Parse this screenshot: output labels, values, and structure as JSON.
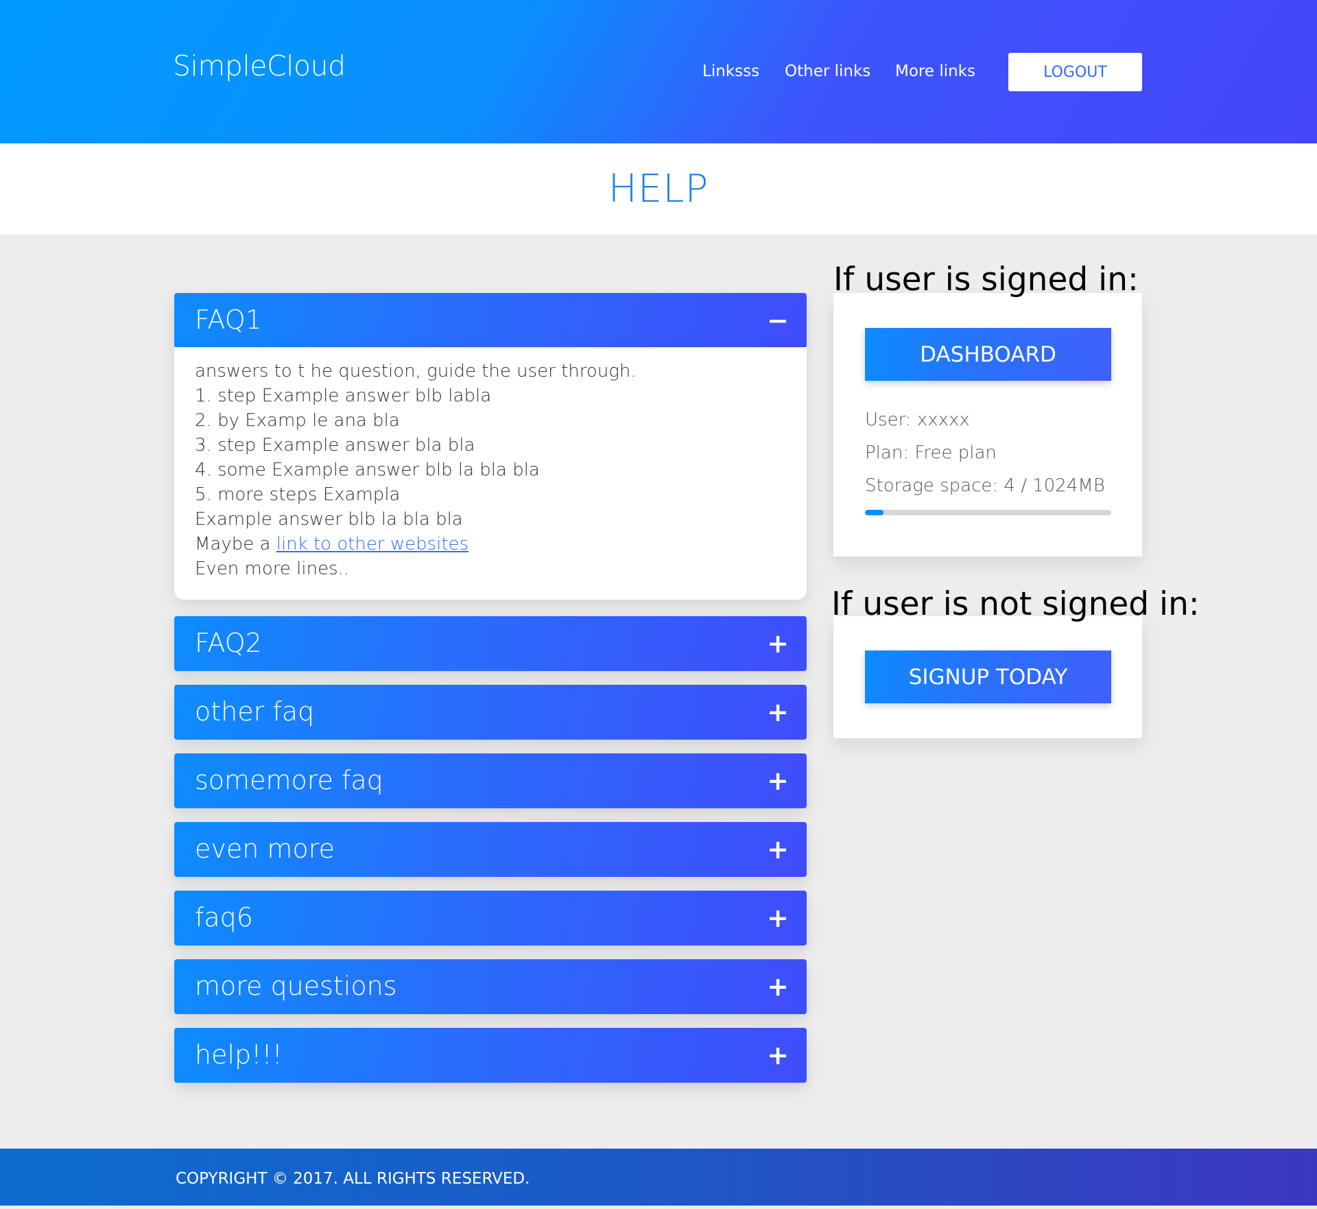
{
  "header": {
    "brand": "SimpleCloud",
    "nav": [
      "Linksss",
      "Other links",
      "More links"
    ],
    "logout_label": "LOGOUT"
  },
  "page": {
    "title": "HELP"
  },
  "faq": {
    "items": [
      {
        "label": "FAQ1",
        "toggle": "−",
        "expanded": true
      },
      {
        "label": "FAQ2",
        "toggle": "+",
        "expanded": false
      },
      {
        "label": "other faq",
        "toggle": "+",
        "expanded": false
      },
      {
        "label": "somemore faq",
        "toggle": "+",
        "expanded": false
      },
      {
        "label": "even more",
        "toggle": "+",
        "expanded": false
      },
      {
        "label": "faq6",
        "toggle": "+",
        "expanded": false
      },
      {
        "label": "more questions",
        "toggle": "+",
        "expanded": false
      },
      {
        "label": "help!!!",
        "toggle": "+",
        "expanded": false
      }
    ],
    "answer": {
      "lines": [
        "answers to t he question, guide the user through.",
        "1. step Example answer blb labla",
        "2. by Examp le ana bla",
        "3. step Example answer bla bla",
        "4. some Example answer blb la bla bla",
        "5. more steps Exampla",
        "Example answer blb la bla bla"
      ],
      "link_prefix": "Maybe a ",
      "link_text": "link to other websites",
      "last_line": "Even more lines.."
    }
  },
  "signed_in": {
    "heading": "If user is signed in:",
    "button_label": "DASHBOARD",
    "user": "User: xxxxx",
    "plan": "Plan: Free plan",
    "storage": "Storage space: 4 / 1024MB",
    "storage_fraction": 0.0039
  },
  "signed_out": {
    "heading": "If user is not signed in:",
    "button_label": "SIGNUP TODAY"
  },
  "footer": {
    "copyright": "COPYRIGHT © 2017. ALL RIGHTS RESERVED."
  },
  "colors": {
    "accent": "#1f7fe8",
    "gradient_start": "#0099ff",
    "gradient_end": "#4446fb",
    "background": "#ededed"
  }
}
